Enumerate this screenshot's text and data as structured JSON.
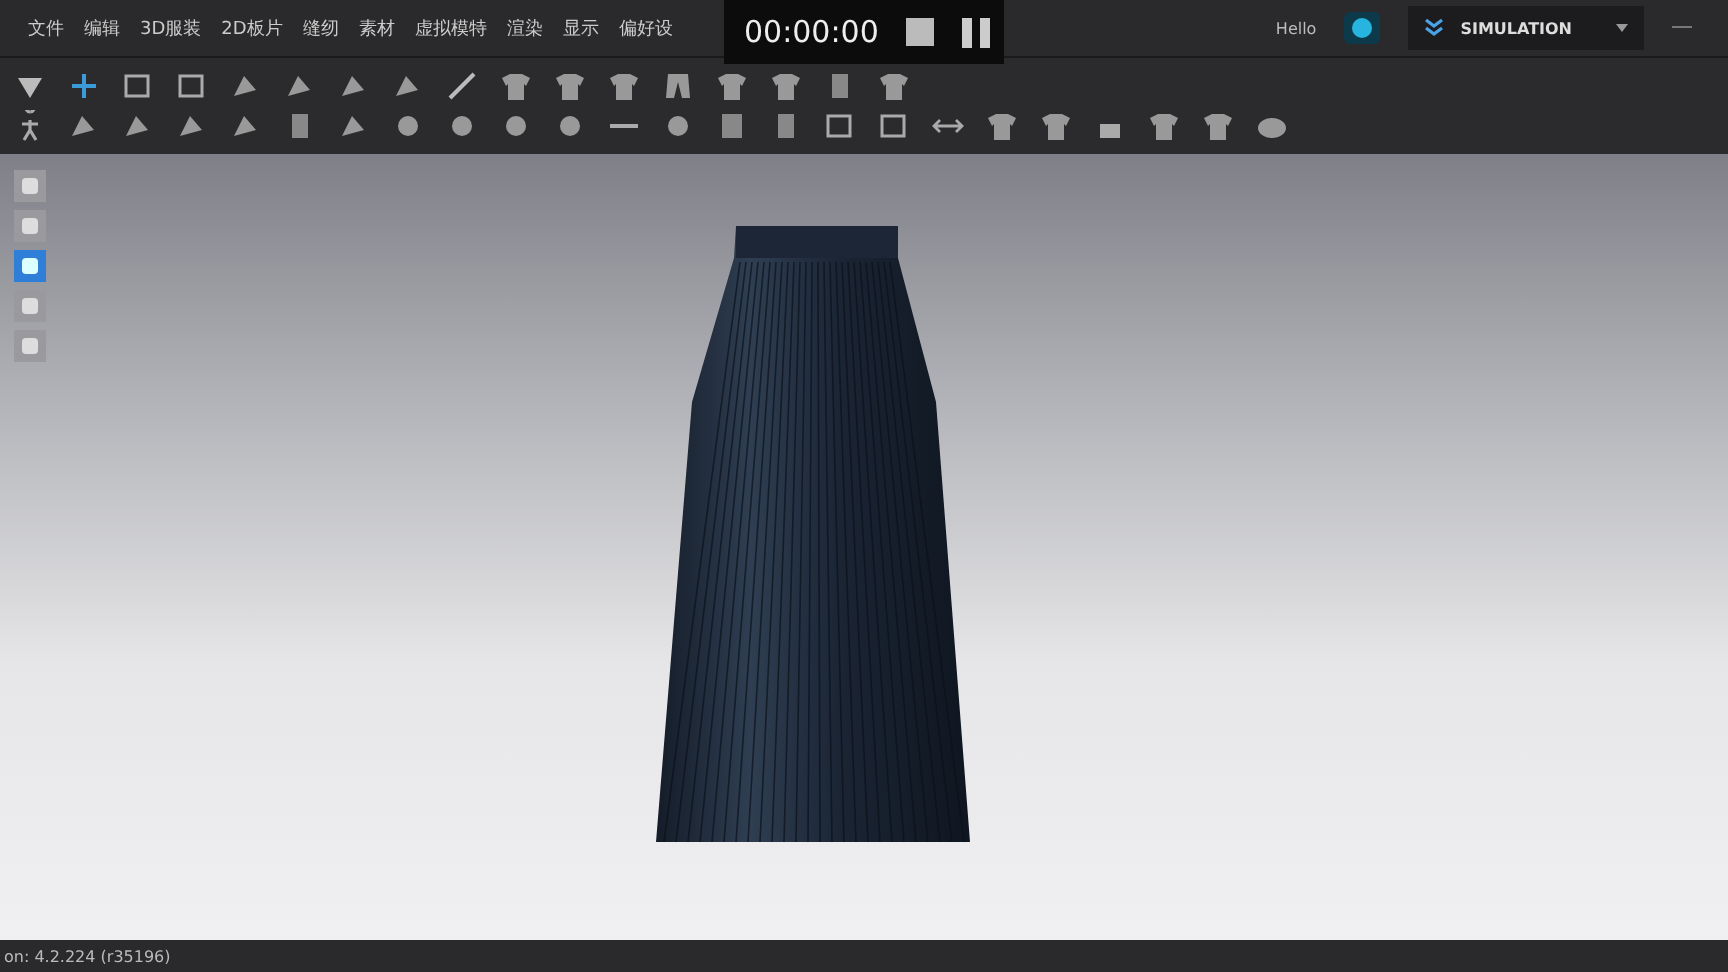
{
  "menu": [
    "文件",
    "编辑",
    "3D服装",
    "2D板片",
    "缝纫",
    "素材",
    "虚拟模特",
    "渲染",
    "显示",
    "偏好设"
  ],
  "recorder": {
    "time": "00:00:00"
  },
  "account": {
    "greeting": "Hello",
    "mode": "SIMULATION"
  },
  "side_tools": [
    {
      "selected": false
    },
    {
      "selected": false
    },
    {
      "selected": true
    },
    {
      "selected": false
    },
    {
      "selected": false
    }
  ],
  "status_bar": {
    "version": "on: 4.2.224 (r35196)"
  }
}
